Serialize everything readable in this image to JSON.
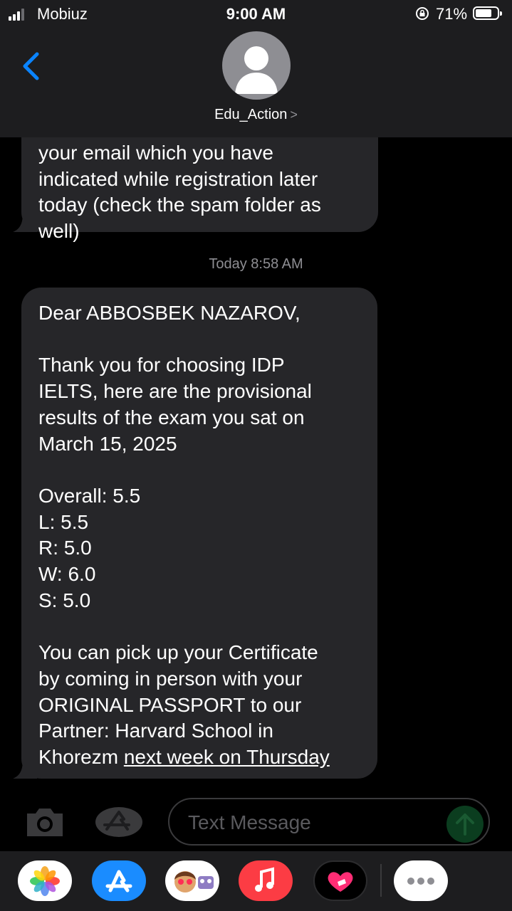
{
  "status": {
    "carrier": "Mobiuz",
    "time": "9:00 AM",
    "battery": "71%"
  },
  "header": {
    "contact": "Edu_Action",
    "chevron": ">"
  },
  "messages": {
    "prev": {
      "lines": [
        "your email which you have",
        "indicated while registration later",
        "today (check the spam folder as",
        "well)"
      ]
    },
    "timestamp_day": "Today",
    "timestamp_time": "8:58 AM",
    "main": {
      "greeting": "Dear ABBOSBEK NAZAROV,",
      "p1": [
        "Thank you for choosing IDP",
        "IELTS, here are the provisional",
        "results of the exam you sat on",
        "March 15, 2025"
      ],
      "scores": [
        "Overall: 5.5",
        "L: 5.5",
        "R: 5.0",
        "W: 6.0",
        "S: 5.0"
      ],
      "p2": [
        "You can pick up your Certificate",
        "by coming in person with your",
        "ORIGINAL PASSPORT to our",
        "Partner: Harvard School in"
      ],
      "last_prefix": "Khorezm ",
      "last_link": "next week on Thursday"
    }
  },
  "composer": {
    "placeholder": "Text Message"
  },
  "icons": [
    "signal-icon",
    "lock-rotation-icon",
    "battery-icon",
    "back-chevron-icon",
    "contact-avatar-icon",
    "camera-icon",
    "app-store-icon",
    "send-arrow-icon",
    "photos-app-icon",
    "app-store-app-icon",
    "memoji-app-icon",
    "music-app-icon",
    "digital-touch-app-icon",
    "more-apps-icon"
  ],
  "colors": {
    "accent": "#0a84ff",
    "bubble": "#262629",
    "bar": "#1d1d1f",
    "send": "#30d158"
  }
}
